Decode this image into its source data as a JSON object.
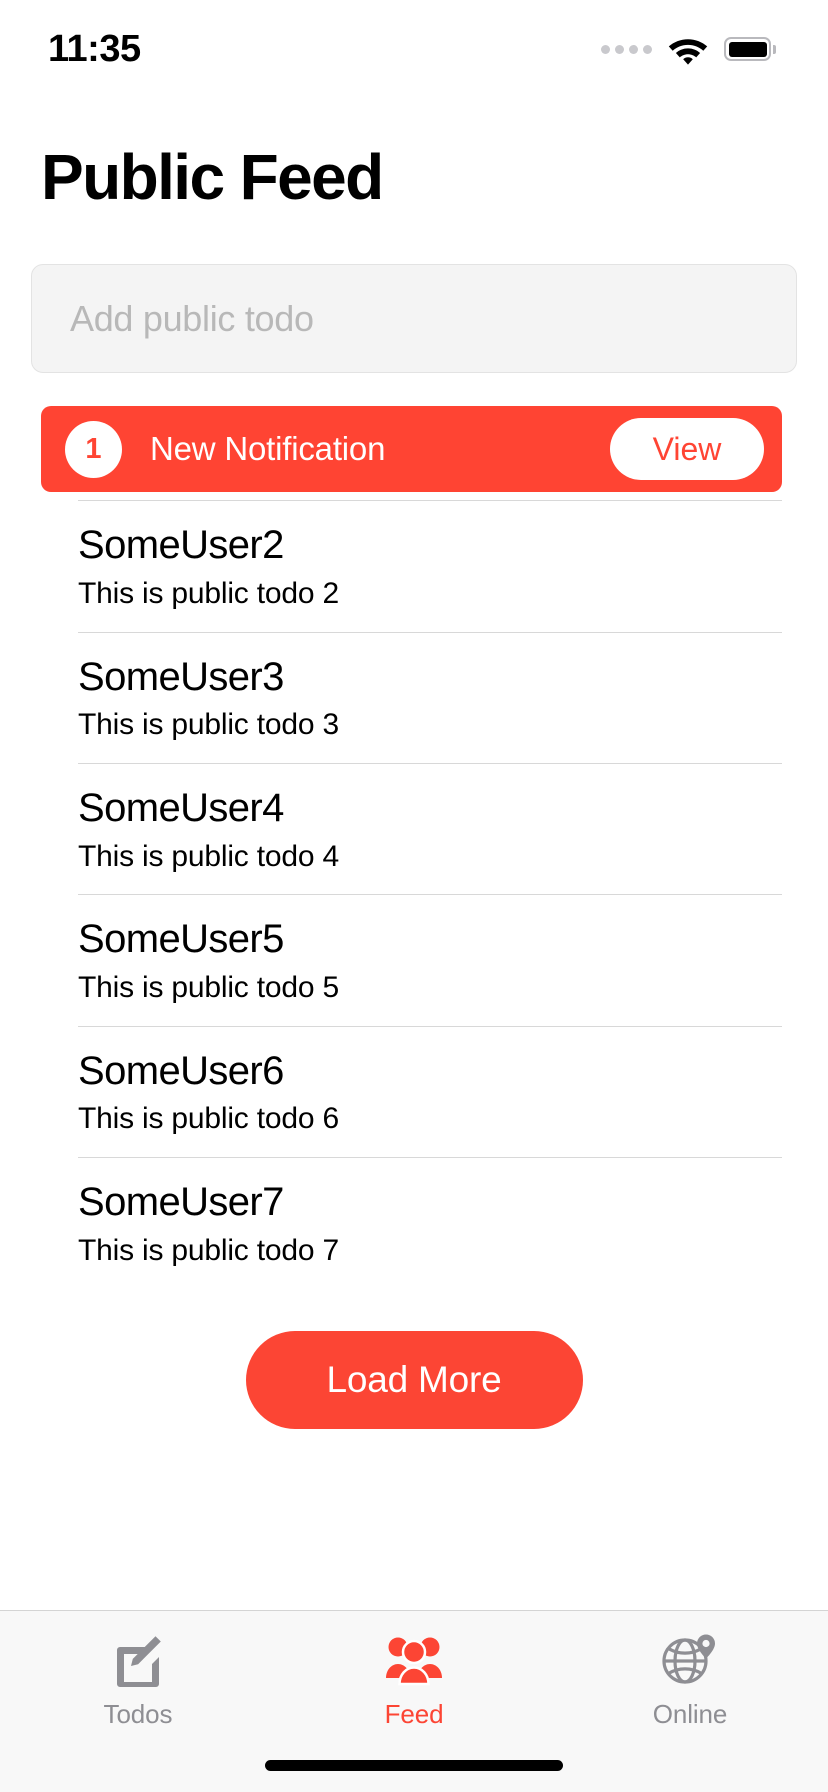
{
  "status_bar": {
    "time": "11:35",
    "signal_icon": "signal-dots-icon",
    "wifi_icon": "wifi-icon",
    "battery_icon": "battery-full-icon"
  },
  "header": {
    "title": "Public Feed"
  },
  "compose": {
    "placeholder": "Add public todo",
    "value": ""
  },
  "notification": {
    "count": "1",
    "message": "New Notification",
    "action_label": "View",
    "background_color": "#ff4433",
    "text_color": "#ffffff"
  },
  "feed": {
    "items": [
      {
        "user": "SomeUser2",
        "text": "This is public todo 2"
      },
      {
        "user": "SomeUser3",
        "text": "This is public todo 3"
      },
      {
        "user": "SomeUser4",
        "text": "This is public todo 4"
      },
      {
        "user": "SomeUser5",
        "text": "This is public todo 5"
      },
      {
        "user": "SomeUser6",
        "text": "This is public todo 6"
      },
      {
        "user": "SomeUser7",
        "text": "This is public todo 7"
      }
    ]
  },
  "load_more": {
    "label": "Load More",
    "color": "#fc4534"
  },
  "tabbar": {
    "active_color": "#fc4534",
    "inactive_color": "#8e8e93",
    "items": [
      {
        "label": "Todos",
        "icon": "compose-icon",
        "active": false
      },
      {
        "label": "Feed",
        "icon": "people-group-icon",
        "active": true
      },
      {
        "label": "Online",
        "icon": "globe-pin-icon",
        "active": false
      }
    ]
  }
}
